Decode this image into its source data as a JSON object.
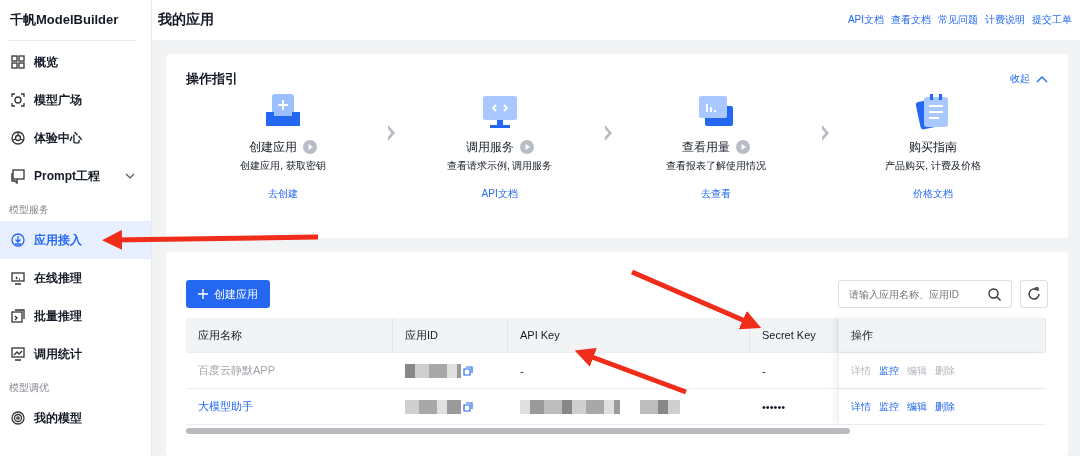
{
  "sidebar": {
    "brand": "千帆ModelBuilder",
    "items": [
      {
        "kind": "item",
        "label": "概览",
        "selected": false
      },
      {
        "kind": "item",
        "label": "模型广场",
        "selected": false
      },
      {
        "kind": "item",
        "label": "体验中心",
        "selected": false
      },
      {
        "kind": "item",
        "label": "Prompt工程",
        "selected": false,
        "expandable": true
      },
      {
        "kind": "group",
        "label": "模型服务"
      },
      {
        "kind": "item",
        "label": "应用接入",
        "selected": true
      },
      {
        "kind": "item",
        "label": "在线推理",
        "selected": false
      },
      {
        "kind": "item",
        "label": "批量推理",
        "selected": false
      },
      {
        "kind": "item",
        "label": "调用统计",
        "selected": false
      },
      {
        "kind": "group",
        "label": "模型调优"
      },
      {
        "kind": "item",
        "label": "我的模型",
        "selected": false
      }
    ]
  },
  "header": {
    "title": "我的应用",
    "links": [
      "API文档",
      "查看文档",
      "常见问题",
      "计费说明",
      "提交工单"
    ]
  },
  "guide": {
    "title": "操作指引",
    "collapse": "收起",
    "steps": [
      {
        "title": "创建应用",
        "video": true,
        "desc": "创建应用, 获取密钥",
        "link": "去创建"
      },
      {
        "title": "调用服务",
        "video": true,
        "desc": "查看请求示例, 调用服务",
        "link": "API文档"
      },
      {
        "title": "查看用量",
        "video": true,
        "desc": "查看报表了解使用情况",
        "link": "去查看"
      },
      {
        "title": "购买指南",
        "video": false,
        "desc": "产品购买, 计费及价格",
        "link": "价格文档"
      }
    ]
  },
  "apps": {
    "create_button": "创建应用",
    "search": {
      "placeholder": "请输入应用名称、应用ID"
    },
    "columns": [
      "应用名称",
      "应用ID",
      "API Key",
      "Secret Key",
      "操作"
    ],
    "rows": [
      {
        "name": "百度云静默APP",
        "link": false,
        "api_key": "-",
        "secret_key": "-",
        "actions": [
          {
            "label": "详情",
            "disabled": true
          },
          {
            "label": "监控",
            "disabled": false
          },
          {
            "label": "编辑",
            "disabled": true
          },
          {
            "label": "删除",
            "disabled": true
          }
        ]
      },
      {
        "name": "大模型助手",
        "link": true,
        "secret_key": "••••••",
        "actions": [
          {
            "label": "详情",
            "disabled": false
          },
          {
            "label": "监控",
            "disabled": false
          },
          {
            "label": "编辑",
            "disabled": false
          },
          {
            "label": "删除",
            "disabled": false
          }
        ]
      }
    ]
  }
}
